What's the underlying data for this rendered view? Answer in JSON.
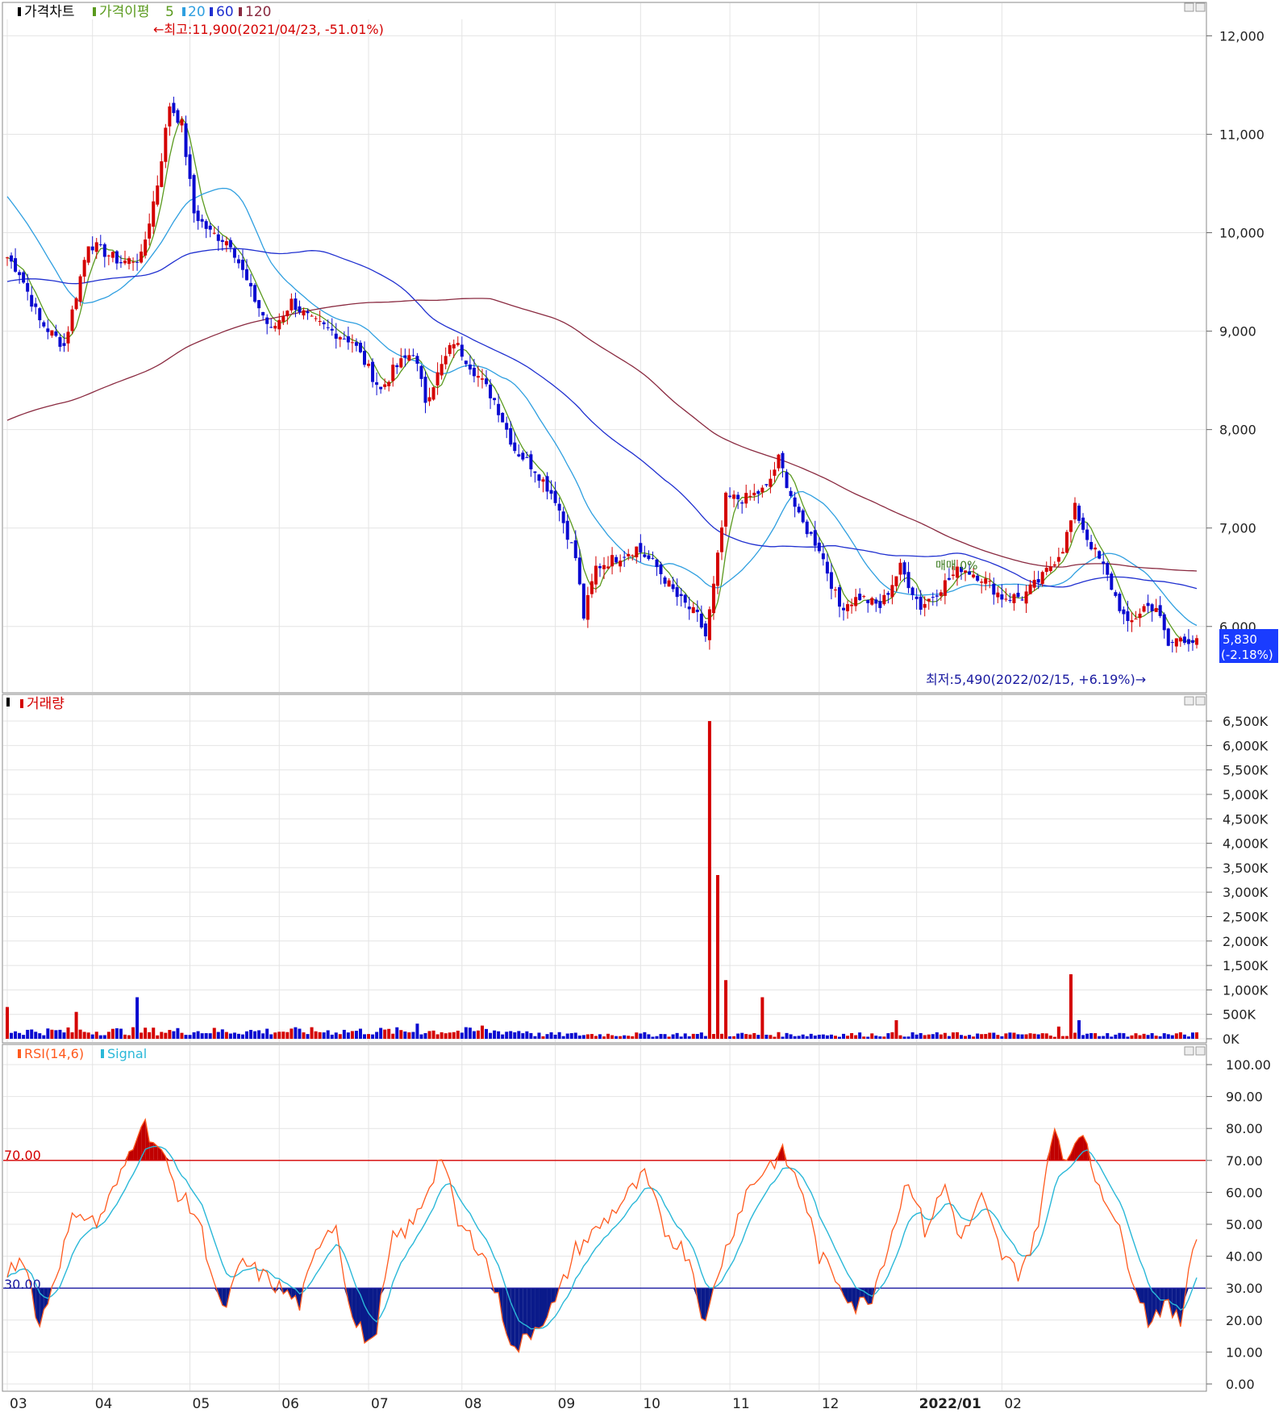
{
  "price_panel": {
    "legend_title": "가격차트",
    "legend_ma": "가격이평",
    "ma_periods": [
      "5",
      "20",
      "60",
      "120"
    ],
    "ma_colors": [
      "#5a9a1e",
      "#2f9fe0",
      "#2030d0",
      "#8a2a40"
    ],
    "high_label": "←최고:11,900(2021/04/23, -51.01%)",
    "low_label": "최저:5,490(2022/02/15, +6.19%)→",
    "current_price": "5,830",
    "current_change": "(-2.18%)",
    "inline_marker": "매매 0%",
    "y_ticks": [
      "12,000",
      "11,000",
      "10,000",
      "9,000",
      "8,000",
      "7,000",
      "6,000"
    ]
  },
  "volume_panel": {
    "legend_title": "거래량",
    "y_ticks": [
      "6,500K",
      "6,000K",
      "5,500K",
      "5,000K",
      "4,500K",
      "4,000K",
      "3,500K",
      "3,000K",
      "2,500K",
      "2,000K",
      "1,500K",
      "1,000K",
      "500K",
      "0K"
    ]
  },
  "rsi_panel": {
    "legend_rsi": "RSI(14,6)",
    "legend_signal": "Signal",
    "upper_label": "70.00",
    "lower_label": "30.00",
    "y_ticks": [
      "100.00",
      "90.00",
      "80.00",
      "70.00",
      "60.00",
      "50.00",
      "40.00",
      "30.00",
      "20.00",
      "10.00",
      "0.00"
    ]
  },
  "x_axis": {
    "labels": [
      "03",
      "04",
      "05",
      "06",
      "07",
      "08",
      "09",
      "10",
      "11",
      "12",
      "2022/01",
      "02"
    ]
  },
  "colors": {
    "up": "#d40000",
    "down": "#0a0ad0",
    "rsi": "#ff5a1e",
    "signal": "#2ab8d8",
    "overbought_fill": "#c00000",
    "oversold_fill": "#0a1a8a",
    "current_box": "#1a3cff"
  },
  "chart_data": [
    {
      "type": "candlestick",
      "title": "가격차트",
      "ylim": [
        5400,
        12200
      ],
      "x_range": [
        "2021-03",
        "2022-02"
      ],
      "series_names": [
        "가격이평 5",
        "20",
        "60",
        "120"
      ],
      "annotations": {
        "high": {
          "value": 11900,
          "date": "2021/04/23",
          "change_pct": -51.01
        },
        "low": {
          "value": 5490,
          "date": "2022/02/15",
          "change_pct": 6.19
        },
        "last": {
          "value": 5830,
          "change_pct": -2.18
        }
      },
      "close_keypoints": [
        [
          0,
          9750
        ],
        [
          3,
          9600
        ],
        [
          8,
          9100
        ],
        [
          14,
          8850
        ],
        [
          20,
          9900
        ],
        [
          28,
          9700
        ],
        [
          33,
          9750
        ],
        [
          37,
          10500
        ],
        [
          40,
          11300
        ],
        [
          43,
          11100
        ],
        [
          46,
          10200
        ],
        [
          50,
          10000
        ],
        [
          55,
          9900
        ],
        [
          60,
          9400
        ],
        [
          65,
          9000
        ],
        [
          70,
          9300
        ],
        [
          75,
          9100
        ],
        [
          85,
          8900
        ],
        [
          92,
          8400
        ],
        [
          95,
          8600
        ],
        [
          100,
          8800
        ],
        [
          103,
          8300
        ],
        [
          110,
          8900
        ],
        [
          115,
          8600
        ],
        [
          120,
          8300
        ],
        [
          125,
          7800
        ],
        [
          130,
          7600
        ],
        [
          135,
          7300
        ],
        [
          140,
          6700
        ],
        [
          142,
          6100
        ],
        [
          145,
          6600
        ],
        [
          150,
          6700
        ],
        [
          155,
          6800
        ],
        [
          160,
          6600
        ],
        [
          165,
          6300
        ],
        [
          170,
          6100
        ],
        [
          172,
          5900
        ],
        [
          174,
          6400
        ],
        [
          177,
          7300
        ],
        [
          182,
          7300
        ],
        [
          187,
          7400
        ],
        [
          190,
          7700
        ],
        [
          195,
          7100
        ],
        [
          200,
          6800
        ],
        [
          205,
          6200
        ],
        [
          210,
          6300
        ],
        [
          215,
          6200
        ],
        [
          220,
          6600
        ],
        [
          225,
          6200
        ],
        [
          230,
          6400
        ],
        [
          235,
          6600
        ],
        [
          240,
          6500
        ],
        [
          245,
          6300
        ],
        [
          250,
          6300
        ],
        [
          255,
          6500
        ],
        [
          260,
          6800
        ],
        [
          263,
          7200
        ],
        [
          266,
          6900
        ],
        [
          270,
          6600
        ],
        [
          273,
          6300
        ],
        [
          276,
          6000
        ],
        [
          280,
          6200
        ],
        [
          283,
          6200
        ],
        [
          286,
          5800
        ],
        [
          289,
          5900
        ],
        [
          293,
          5830
        ]
      ]
    },
    {
      "type": "bar",
      "title": "거래량",
      "ylim": [
        0,
        6600000
      ],
      "baseline_volume": 110000,
      "spikes": [
        [
          0,
          650000
        ],
        [
          17,
          550000
        ],
        [
          32,
          850000
        ],
        [
          101,
          310000
        ],
        [
          117,
          270000
        ],
        [
          173,
          6500000
        ],
        [
          175,
          3350000
        ],
        [
          177,
          1200000
        ],
        [
          186,
          850000
        ],
        [
          219,
          380000
        ],
        [
          259,
          250000
        ],
        [
          262,
          1320000
        ],
        [
          264,
          380000
        ]
      ]
    },
    {
      "type": "line",
      "title": "RSI(14,6)",
      "ylim": [
        0,
        100
      ],
      "levels": [
        70,
        30
      ],
      "series_names": [
        "RSI(14,6)",
        "Signal"
      ],
      "rsi_keypoints": [
        [
          0,
          35
        ],
        [
          4,
          40
        ],
        [
          8,
          18
        ],
        [
          12,
          35
        ],
        [
          17,
          55
        ],
        [
          22,
          50
        ],
        [
          28,
          65
        ],
        [
          33,
          83
        ],
        [
          38,
          72
        ],
        [
          42,
          60
        ],
        [
          47,
          52
        ],
        [
          53,
          22
        ],
        [
          58,
          38
        ],
        [
          65,
          32
        ],
        [
          72,
          25
        ],
        [
          78,
          48
        ],
        [
          81,
          50
        ],
        [
          85,
          20
        ],
        [
          90,
          12
        ],
        [
          95,
          45
        ],
        [
          100,
          50
        ],
        [
          107,
          72
        ],
        [
          111,
          50
        ],
        [
          117,
          42
        ],
        [
          122,
          22
        ],
        [
          125,
          10
        ],
        [
          130,
          18
        ],
        [
          135,
          25
        ],
        [
          140,
          42
        ],
        [
          145,
          48
        ],
        [
          150,
          55
        ],
        [
          157,
          65
        ],
        [
          162,
          48
        ],
        [
          168,
          40
        ],
        [
          172,
          18
        ],
        [
          175,
          35
        ],
        [
          182,
          60
        ],
        [
          187,
          68
        ],
        [
          191,
          72
        ],
        [
          196,
          60
        ],
        [
          200,
          40
        ],
        [
          205,
          32
        ],
        [
          209,
          24
        ],
        [
          213,
          28
        ],
        [
          218,
          48
        ],
        [
          222,
          65
        ],
        [
          226,
          48
        ],
        [
          231,
          62
        ],
        [
          235,
          45
        ],
        [
          240,
          58
        ],
        [
          245,
          40
        ],
        [
          249,
          35
        ],
        [
          253,
          45
        ],
        [
          258,
          80
        ],
        [
          261,
          70
        ],
        [
          264,
          80
        ],
        [
          268,
          65
        ],
        [
          272,
          55
        ],
        [
          277,
          35
        ],
        [
          281,
          20
        ],
        [
          285,
          25
        ],
        [
          289,
          19
        ],
        [
          292,
          45
        ],
        [
          295,
          47
        ],
        [
          297,
          40
        ]
      ]
    }
  ]
}
